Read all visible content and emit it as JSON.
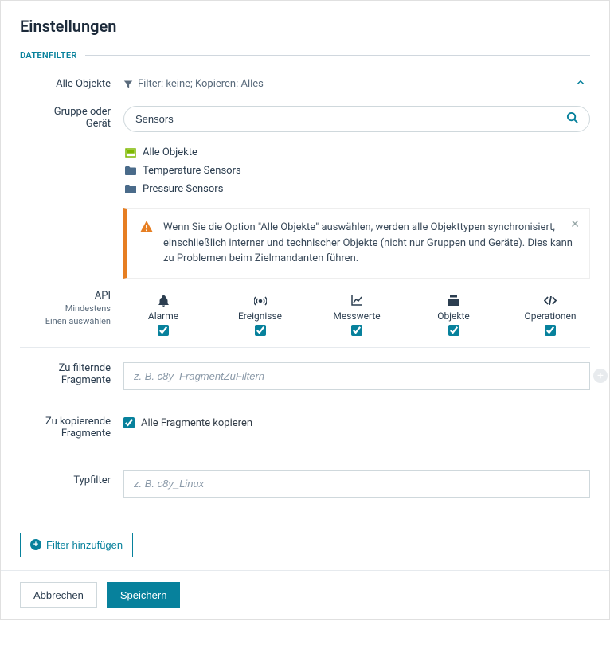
{
  "title": "Einstellungen",
  "section_label": "DATENFILTER",
  "all_objects_label": "Alle Objekte",
  "filter_summary": "Filter: keine; Kopieren: Alles",
  "group_label_line1": "Gruppe oder",
  "group_label_line2": "Gerät",
  "search_value": "Sensors",
  "tree": {
    "all": "Alle Objekte",
    "item1": "Temperature Sensors",
    "item2": "Pressure Sensors"
  },
  "alert_text": "Wenn Sie die Option \"Alle Objekte\" auswählen, werden alle Objekttypen synchronisiert, einschließlich interner und technischer Objekte (nicht nur Gruppen und Geräte). Dies kann zu Problemen beim Zielmandanten führen.",
  "api_label": "API",
  "api_sub1": "Mindestens",
  "api_sub2": "Einen auswählen",
  "api_items": {
    "alarms": "Alarme",
    "events": "Ereignisse",
    "measurements": "Messwerte",
    "objects": "Objekte",
    "operations": "Operationen"
  },
  "filter_fragments_label_1": "Zu filternde",
  "filter_fragments_label_2": "Fragmente",
  "filter_fragments_placeholder": "z. B. c8y_FragmentZuFiltern",
  "copy_fragments_label_1": "Zu kopierende",
  "copy_fragments_label_2": "Fragmente",
  "copy_all_label": "Alle Fragmente kopieren",
  "typefilter_label": "Typfilter",
  "typefilter_placeholder": "z. B. c8y_Linux",
  "add_filter_label": "Filter hinzufügen",
  "cancel_label": "Abbrechen",
  "save_label": "Speichern"
}
